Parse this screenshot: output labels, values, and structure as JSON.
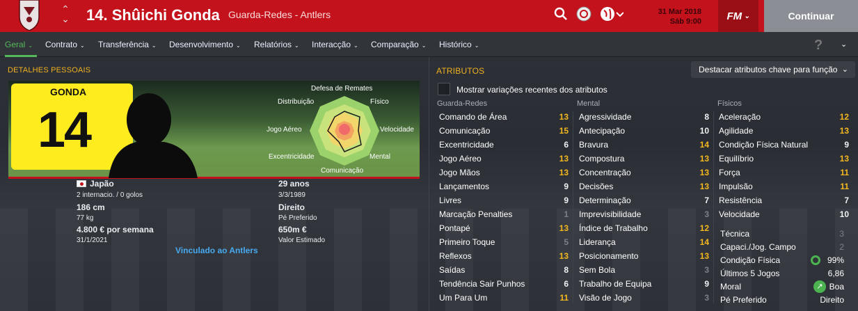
{
  "header": {
    "player_name": "14. Shûichi Gonda",
    "role": "Guarda-Redes - Antlers",
    "date_line1": "31 Mar 2018",
    "date_line2": "Sáb 9:00",
    "fm_label": "FM",
    "continue_label": "Continuar"
  },
  "menu": {
    "tabs": [
      "Geral",
      "Contrato",
      "Transferência",
      "Desenvolvimento",
      "Relatórios",
      "Interacção",
      "Comparação",
      "Histórico"
    ],
    "help": "?"
  },
  "personal": {
    "title": "DETALHES PESSOAIS",
    "shirt_name": "GONDA",
    "shirt_number": "14",
    "nationality": "Japão",
    "caps": "2 internacio. / 0 golos",
    "height": "186 cm",
    "weight": "77 kg",
    "wage": "4.800 € por semana",
    "contract_end": "31/1/2021",
    "age": "29 anos",
    "birth_date": "3/3/1989",
    "foot": "Direito",
    "foot_label": "Pé Preferido",
    "value": "650m €",
    "value_label": "Valor Estimado",
    "link": "Vinculado ao Antlers"
  },
  "radar_labels": {
    "top": "Defesa de Remates",
    "tr": "Físico",
    "r": "Velocidade",
    "br": "Mental",
    "bottom": "Comunicação",
    "bl": "Excentricidade",
    "l": "Jogo Aéreo",
    "tl": "Distribuição"
  },
  "attributes": {
    "title": "ATRIBUTOS",
    "highlight": "Destacar atributos chave para função",
    "show_changes": "Mostrar variações recentes dos atributos",
    "gk_header": "Guarda-Redes",
    "mental_header": "Mental",
    "physical_header": "Físicos",
    "gk": [
      [
        "Comando de Área",
        "13",
        "y"
      ],
      [
        "Comunicação",
        "15",
        "y"
      ],
      [
        "Excentricidade",
        "6",
        "w"
      ],
      [
        "Jogo Aéreo",
        "13",
        "y"
      ],
      [
        "Jogo Mãos",
        "13",
        "y"
      ],
      [
        "Lançamentos",
        "9",
        "w"
      ],
      [
        "Livres",
        "9",
        "w"
      ],
      [
        "Marcação Penalties",
        "1",
        "g"
      ],
      [
        "Pontapé",
        "13",
        "y"
      ],
      [
        "Primeiro Toque",
        "5",
        "g"
      ],
      [
        "Reflexos",
        "13",
        "y"
      ],
      [
        "Saídas",
        "8",
        "w"
      ],
      [
        "Tendência Sair Punhos",
        "6",
        "w"
      ],
      [
        "Um Para Um",
        "11",
        "y"
      ]
    ],
    "mental": [
      [
        "Agressividade",
        "8",
        "w"
      ],
      [
        "Antecipação",
        "10",
        "w"
      ],
      [
        "Bravura",
        "14",
        "y"
      ],
      [
        "Compostura",
        "13",
        "y"
      ],
      [
        "Concentração",
        "13",
        "y"
      ],
      [
        "Decisões",
        "13",
        "y"
      ],
      [
        "Determinação",
        "7",
        "w"
      ],
      [
        "Imprevisibilidade",
        "3",
        "g"
      ],
      [
        "Índice de Trabalho",
        "12",
        "y"
      ],
      [
        "Liderança",
        "14",
        "y"
      ],
      [
        "Posicionamento",
        "13",
        "y"
      ],
      [
        "Sem Bola",
        "3",
        "g"
      ],
      [
        "Trabalho de Equipa",
        "9",
        "w"
      ],
      [
        "Visão de Jogo",
        "3",
        "g"
      ]
    ],
    "physical": [
      [
        "Aceleração",
        "12",
        "y"
      ],
      [
        "Agilidade",
        "13",
        "y"
      ],
      [
        "Condição Física Natural",
        "9",
        "w"
      ],
      [
        "Equilíbrio",
        "13",
        "y"
      ],
      [
        "Força",
        "11",
        "y"
      ],
      [
        "Impulsão",
        "11",
        "y"
      ],
      [
        "Resistência",
        "7",
        "w"
      ],
      [
        "Velocidade",
        "10",
        "w"
      ]
    ],
    "extra": [
      [
        "Técnica",
        "3"
      ],
      [
        "Capaci./Jog. Campo",
        "2"
      ],
      [
        "Condição Física",
        "99%"
      ],
      [
        "Últimos 5 Jogos",
        "6,86"
      ],
      [
        "Moral",
        "Boa"
      ],
      [
        "Pé Preferido",
        "Direito"
      ]
    ]
  }
}
